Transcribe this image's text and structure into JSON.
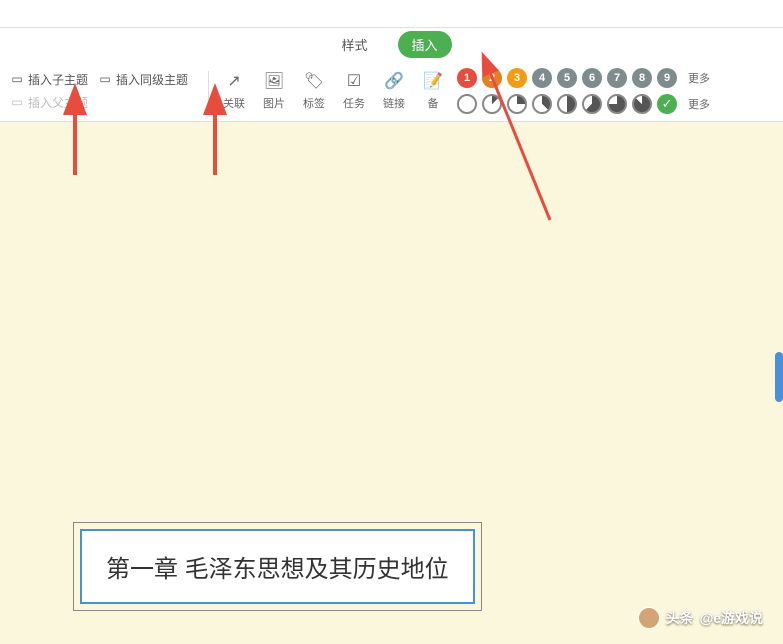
{
  "tabs": {
    "style": "样式",
    "insert": "插入"
  },
  "toolbar": {
    "insert_subtopic": "插入子主题",
    "insert_sibling": "插入同级主题",
    "insert_parent": "插入父主题",
    "relation": "关联",
    "image": "图片",
    "tag": "标签",
    "task": "任务",
    "link": "链接",
    "note": "备"
  },
  "markers": {
    "numbers": [
      "1",
      "2",
      "3",
      "4",
      "5",
      "6",
      "7",
      "8",
      "9"
    ],
    "num_colors": [
      "#e74c3c",
      "#e67e22",
      "#f39c12",
      "#7f8c8d",
      "#7f8c8d",
      "#7f8c8d",
      "#7f8c8d",
      "#7f8c8d",
      "#7f8c8d"
    ],
    "progress_fills": [
      0,
      12.5,
      25,
      37.5,
      50,
      62.5,
      75,
      87.5
    ],
    "more": "更多"
  },
  "node": {
    "text": "第一章 毛泽东思想及其历史地位"
  },
  "watermark": {
    "prefix": "头条",
    "handle": "@e游戏说"
  }
}
